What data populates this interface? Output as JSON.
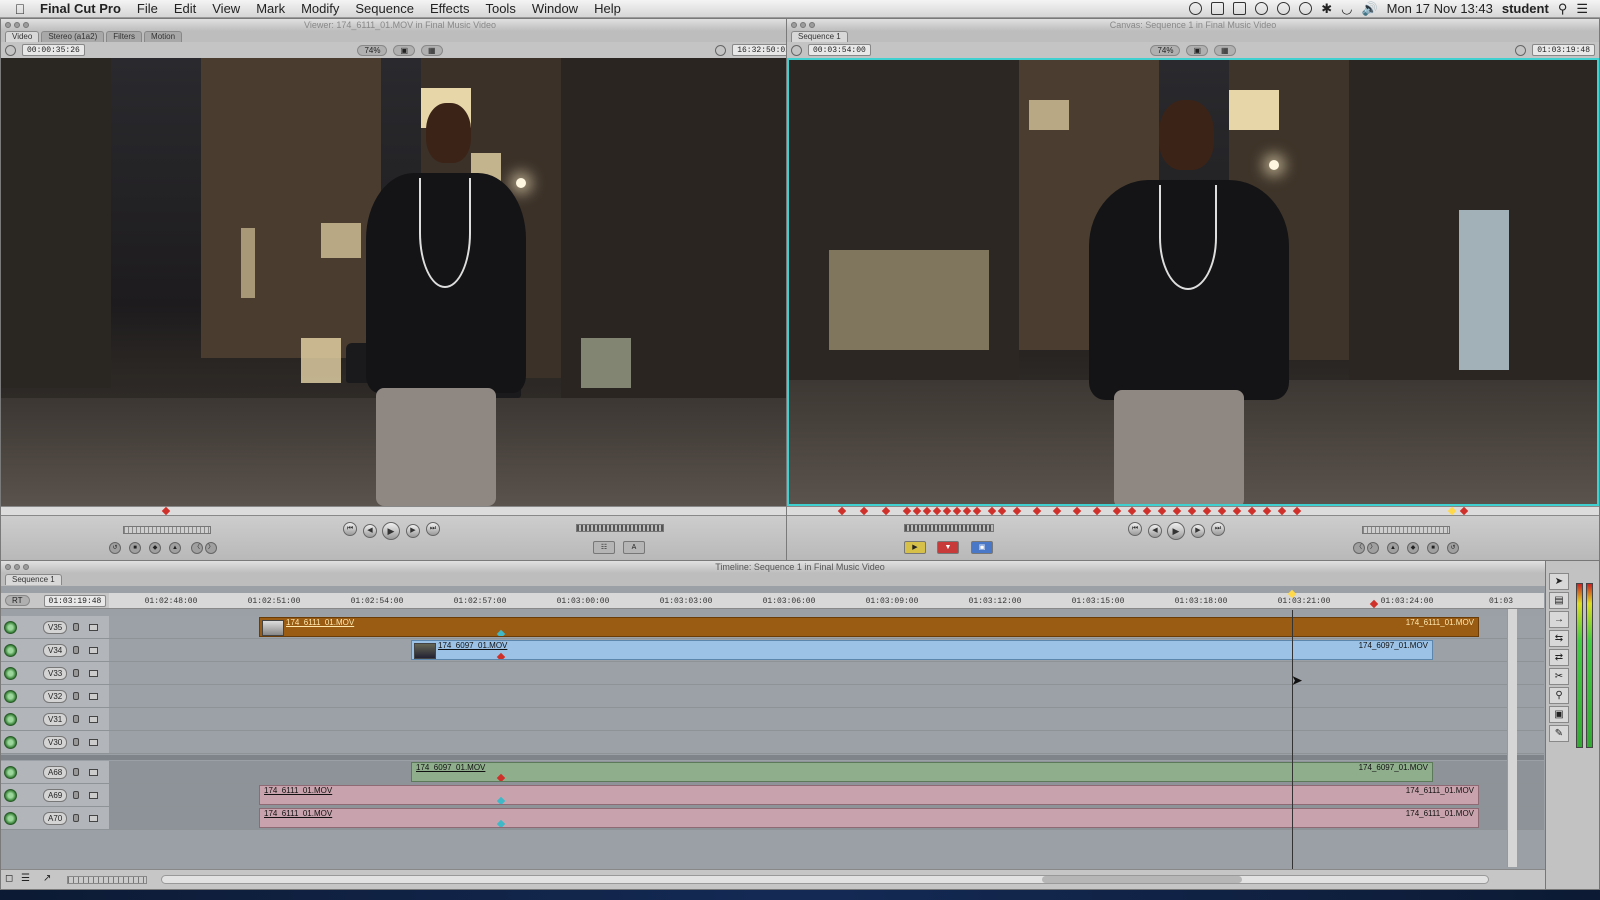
{
  "menubar": {
    "apple": "",
    "app_name": "Final Cut Pro",
    "menus": [
      "File",
      "Edit",
      "View",
      "Mark",
      "Modify",
      "Sequence",
      "Effects",
      "Tools",
      "Window",
      "Help"
    ],
    "clock": "Mon 17 Nov  13:43",
    "user": "student",
    "status_icons": [
      "sync-icon",
      "shield-icon",
      "drive-icon",
      "x-circle-icon",
      "headphones-icon",
      "time-machine-icon",
      "bluetooth-icon",
      "wifi-icon",
      "volume-icon",
      "search-icon",
      "list-icon"
    ]
  },
  "viewer": {
    "title": "Viewer: 174_6111_01.MOV in Final Music Video",
    "tabs": [
      "Video",
      "Stereo (a1a2)",
      "Filters",
      "Motion"
    ],
    "timecode_duration": "00:00:35:26",
    "zoom": "74%",
    "timecode_current": "16:32:50:02"
  },
  "canvas": {
    "title": "Canvas: Sequence 1 in Final Music Video",
    "tab": "Sequence 1",
    "timecode_duration": "00:03:54:00",
    "zoom": "74%",
    "timecode_current": "01:03:19:48"
  },
  "timeline": {
    "title": "Timeline: Sequence 1 in Final Music Video",
    "sequence_tab": "Sequence 1",
    "rt_label": "RT",
    "current_timecode": "01:03:19:48",
    "ruler": [
      "01:02:48:00",
      "01:02:51:00",
      "01:02:54:00",
      "01:02:57:00",
      "01:03:00:00",
      "01:03:03:00",
      "01:03:06:00",
      "01:03:09:00",
      "01:03:12:00",
      "01:03:15:00",
      "01:03:18:00",
      "01:03:21:00",
      "01:03:24:00",
      "01:03"
    ],
    "video_tracks": [
      "V35",
      "V34",
      "V33",
      "V32",
      "V31",
      "V30"
    ],
    "audio_tracks": [
      "A68",
      "A69",
      "A70"
    ],
    "clips": {
      "v35": "174_6111_01.MOV",
      "v34": "174_6097_01.MOV",
      "a68": "174_6097_01.MOV",
      "a69": "174_6111_01.MOV",
      "a70": "174_6111_01.MOV"
    }
  },
  "colors": {
    "video_clip_orange": "#9a5c12",
    "video_clip_blue": "#9cc3e6",
    "audio_clip_green": "#8fae8c",
    "audio_clip_pink": "#c8a3ad",
    "canvas_border": "#3fd0cf",
    "marker_red": "#d0302a",
    "marker_cyan": "#3fb8c8"
  }
}
